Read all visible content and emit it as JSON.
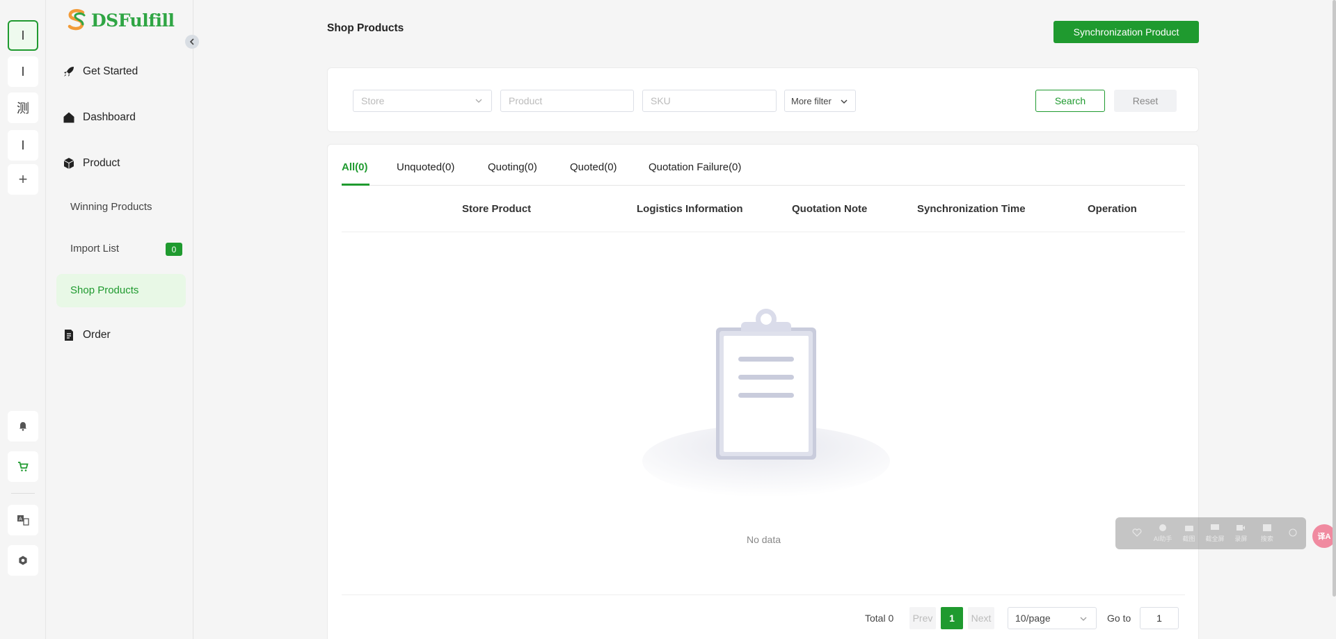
{
  "rail": {
    "items": [
      {
        "label": "I",
        "name": "rail-item-1"
      },
      {
        "label": "I",
        "name": "rail-item-2"
      },
      {
        "label": "测",
        "name": "rail-item-3"
      },
      {
        "label": "I",
        "name": "rail-item-4"
      },
      {
        "label": "+",
        "name": "rail-add"
      }
    ]
  },
  "brand": {
    "name": "DSFulfill",
    "accent": "#1f9a2f"
  },
  "nav": {
    "get_started": "Get Started",
    "dashboard": "Dashboard",
    "product": "Product",
    "winning_products": "Winning Products",
    "import_list": "Import List",
    "import_list_count": "0",
    "shop_products": "Shop Products",
    "order": "Order"
  },
  "header": {
    "title": "Shop Products",
    "sync_button": "Synchronization Product"
  },
  "filters": {
    "store_placeholder": "Store",
    "product_placeholder": "Product",
    "sku_placeholder": "SKU",
    "more_filter": "More filter",
    "search": "Search",
    "reset": "Reset"
  },
  "tabs": [
    {
      "label": "All(0)",
      "active": true
    },
    {
      "label": "Unquoted(0)"
    },
    {
      "label": "Quoting(0)"
    },
    {
      "label": "Quoted(0)"
    },
    {
      "label": "Quotation Failure(0)"
    }
  ],
  "columns": [
    "Store Product",
    "Logistics Information",
    "Quotation Note",
    "Synchronization Time",
    "Operation"
  ],
  "empty_text": "No data",
  "pagination": {
    "total": "Total 0",
    "prev": "Prev",
    "current": "1",
    "next": "Next",
    "page_size": "10/page",
    "goto_label": "Go to",
    "goto_value": "1"
  },
  "float_toolbar": {
    "items": [
      "AI助手",
      "截图",
      "截全屏",
      "录屏",
      "搜索"
    ],
    "circle": "译A"
  }
}
